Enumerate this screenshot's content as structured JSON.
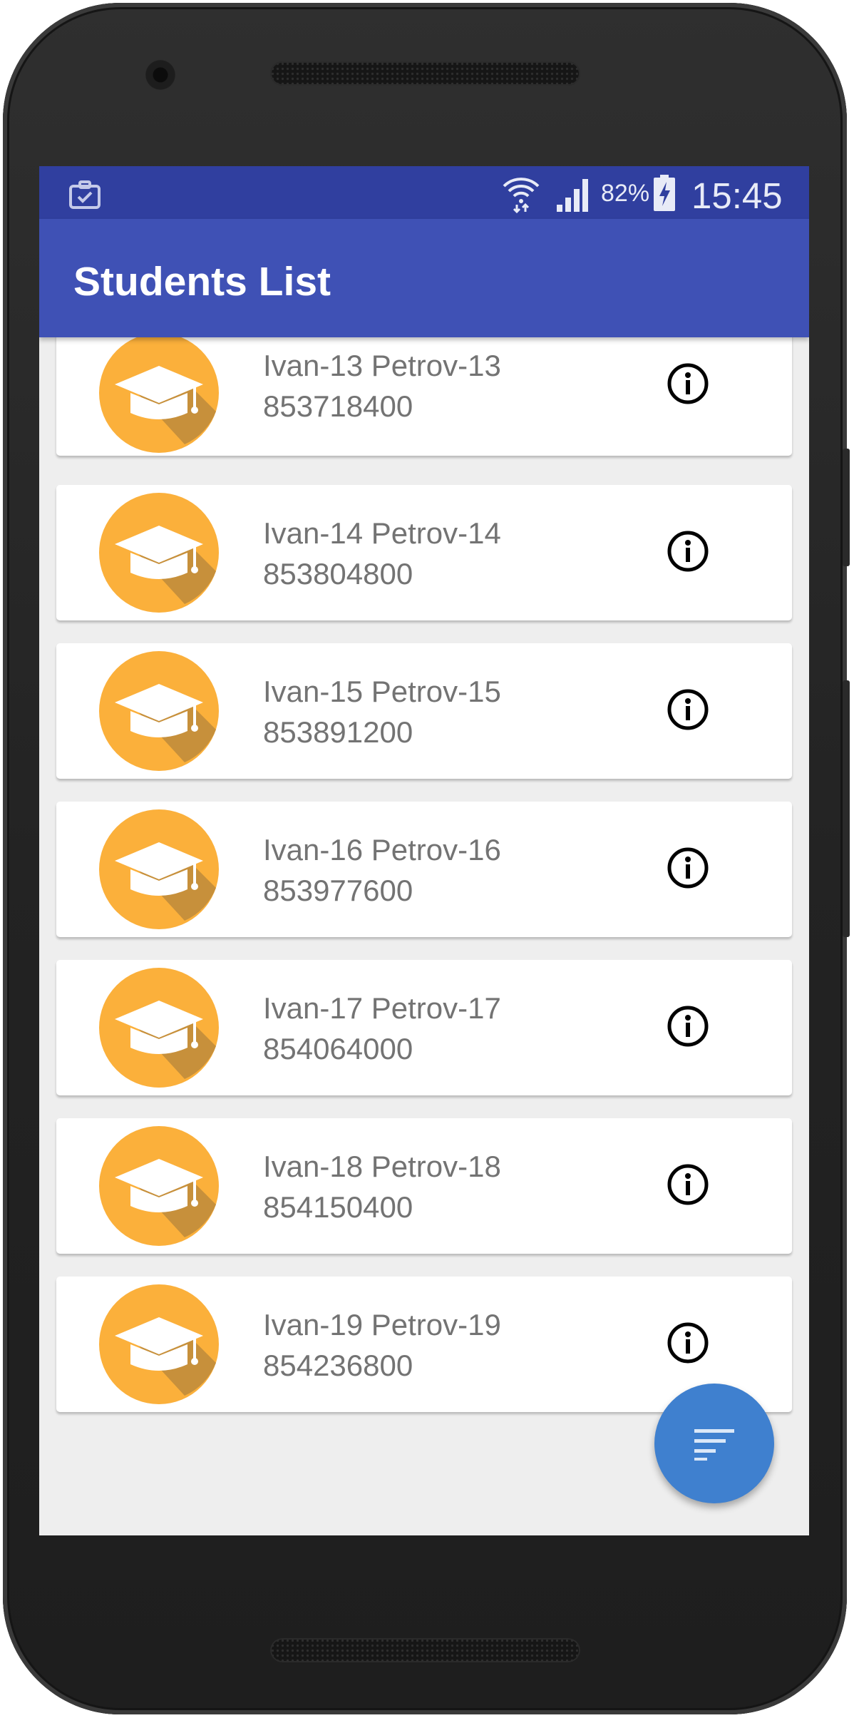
{
  "status_bar": {
    "notification_icon": "clipboard-check-icon",
    "wifi_icon": "wifi-icon",
    "signal_icon": "cell-signal-icon",
    "battery_percent": "82%",
    "battery_icon": "battery-charging-icon",
    "time": "15:45",
    "background_color": "#303f9f"
  },
  "app_bar": {
    "title": "Students List",
    "background_color": "#3f51b5"
  },
  "students": [
    {
      "name": "Ivan-13 Petrov-13",
      "number": "853718400"
    },
    {
      "name": "Ivan-14 Petrov-14",
      "number": "853804800"
    },
    {
      "name": "Ivan-15 Petrov-15",
      "number": "853891200"
    },
    {
      "name": "Ivan-16 Petrov-16",
      "number": "853977600"
    },
    {
      "name": "Ivan-17 Petrov-17",
      "number": "854064000"
    },
    {
      "name": "Ivan-18 Petrov-18",
      "number": "854150400"
    },
    {
      "name": "Ivan-19 Petrov-19",
      "number": "854236800"
    }
  ],
  "list_item_icons": {
    "avatar": "graduation-cap-icon",
    "action": "info-icon"
  },
  "fab": {
    "icon": "sort-icon",
    "color": "#3f80cf"
  },
  "accent_colors": {
    "avatar_circle": "#fbb03b",
    "avatar_shadow": "#c7903b"
  }
}
